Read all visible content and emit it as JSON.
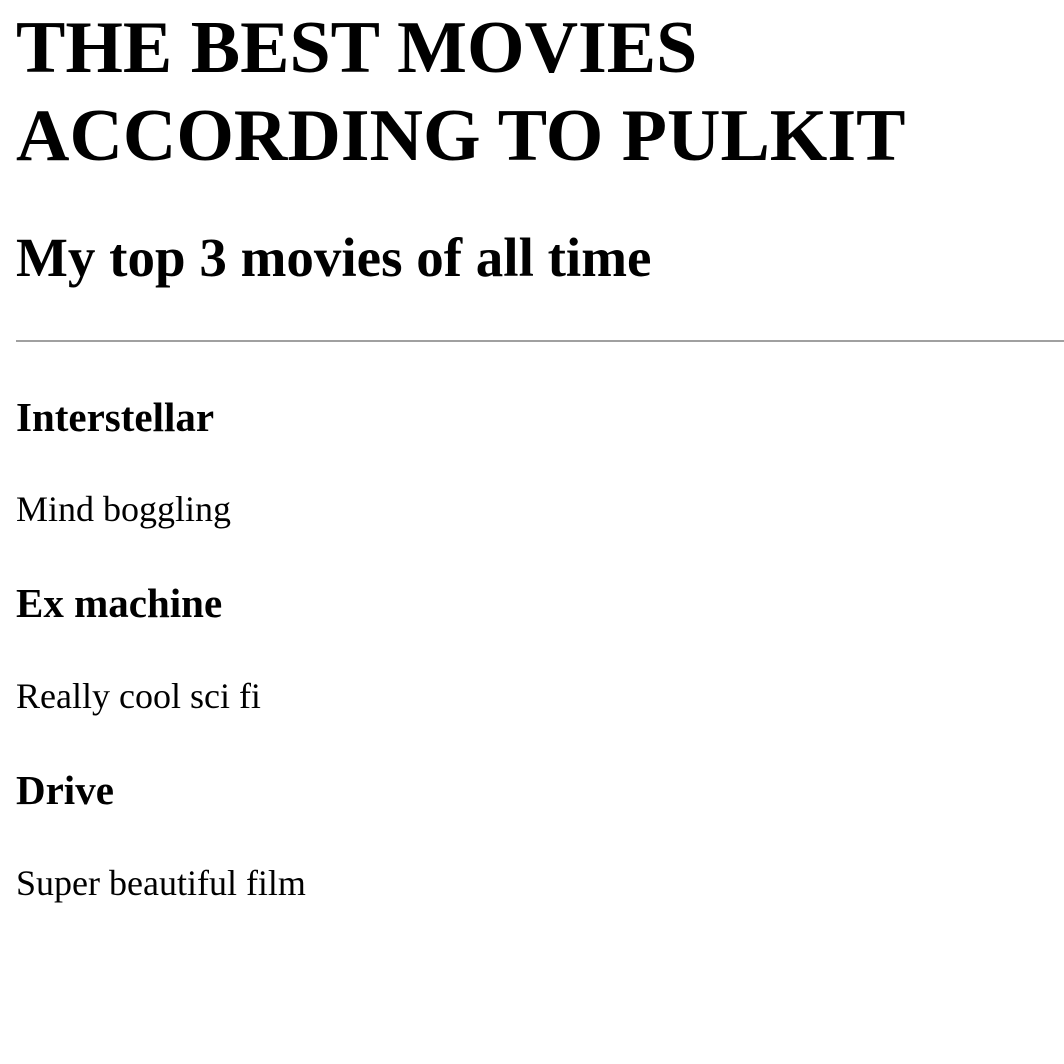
{
  "header": {
    "title_line1": "THE BEST MOVIES",
    "title_line2": "ACCORDING TO PULKIT",
    "subtitle": "My top 3 movies of all time"
  },
  "movies": [
    {
      "title": "Interstellar",
      "description": "Mind boggling"
    },
    {
      "title": "Ex machine",
      "description": "Really cool sci fi"
    },
    {
      "title": "Drive",
      "description": "Super beautiful film"
    }
  ]
}
